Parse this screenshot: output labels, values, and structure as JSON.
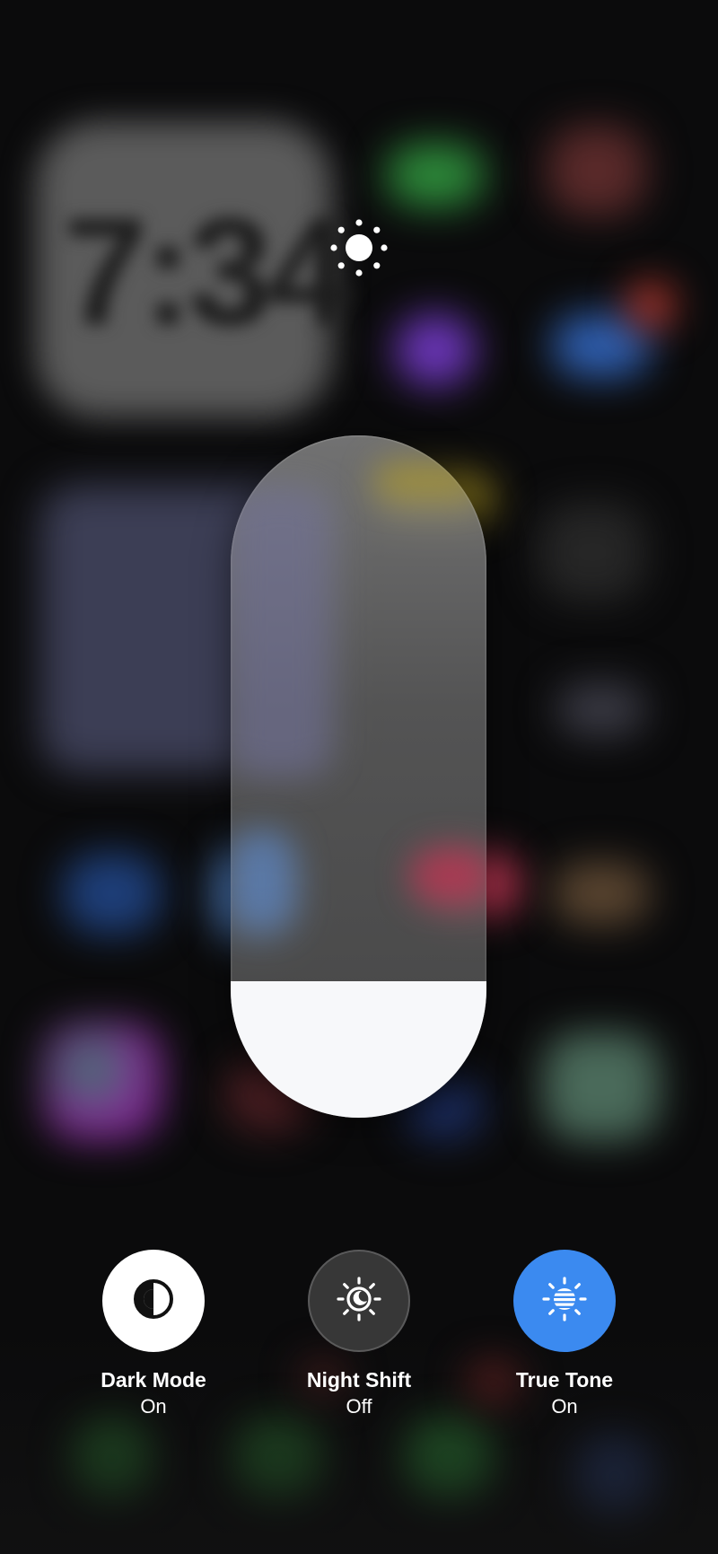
{
  "brightness": {
    "icon": "brightness-sun-icon",
    "level": 0.2
  },
  "controls": [
    {
      "id": "dark-mode",
      "label": "Dark Mode",
      "status": "On",
      "icon": "dark-mode-icon",
      "active": true,
      "color": "#ffffff"
    },
    {
      "id": "night-shift",
      "label": "Night Shift",
      "status": "Off",
      "icon": "night-shift-icon",
      "active": false,
      "color": "#3c3c3c"
    },
    {
      "id": "true-tone",
      "label": "True Tone",
      "status": "On",
      "icon": "true-tone-icon",
      "active": true,
      "color": "#3b8af0"
    }
  ],
  "background": {
    "blurred_clock": "7:34"
  },
  "colors": {
    "accent_blue": "#3b8af0",
    "slider_fill": "#f7f8fa"
  }
}
